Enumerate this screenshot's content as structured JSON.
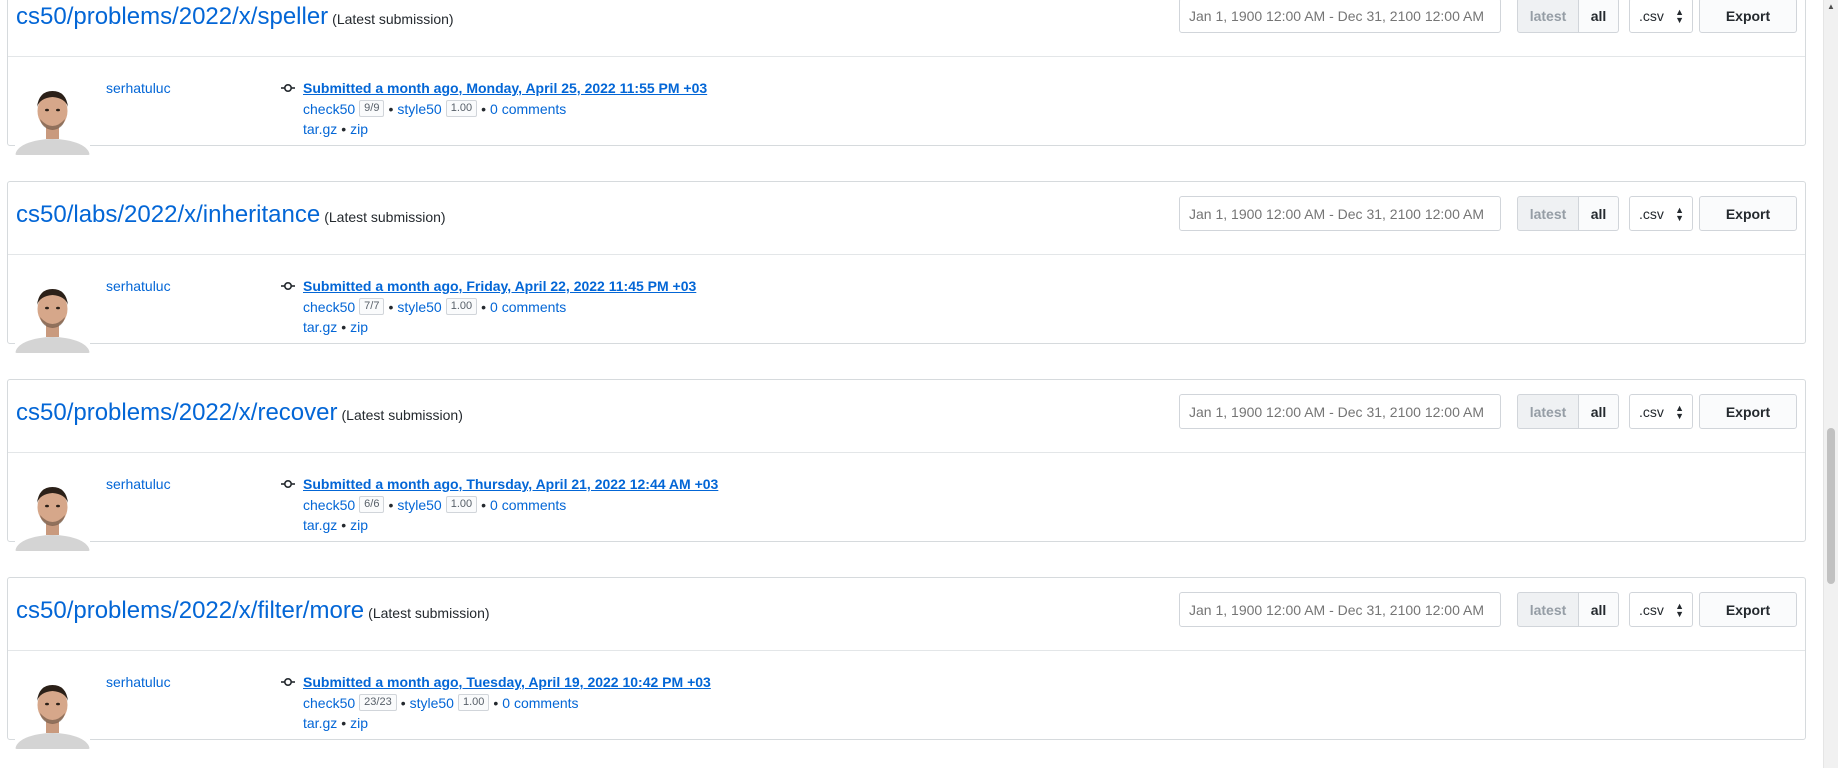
{
  "colors": {
    "link": "#0366d6",
    "border": "#d6dadd",
    "text": "#24292e"
  },
  "submissions": [
    {
      "slug": "cs50/problems/2022/x/speller",
      "note": "(Latest submission)",
      "date_range_placeholder": "Jan 1, 1900 12:00 AM - Dec 31, 2100 12:00 AM",
      "latest_label": "latest",
      "all_label": "all",
      "format": ".csv",
      "export_label": "Export",
      "user": "serhatuluc",
      "submitted": "Submitted a month ago, Monday, April 25, 2022 11:55 PM +03",
      "check_label": "check50",
      "check_score": "9/9",
      "style_label": "style50",
      "style_score": "1.00",
      "comments": "0 comments",
      "targz": "tar.gz",
      "zip": "zip"
    },
    {
      "slug": "cs50/labs/2022/x/inheritance",
      "note": "(Latest submission)",
      "date_range_placeholder": "Jan 1, 1900 12:00 AM - Dec 31, 2100 12:00 AM",
      "latest_label": "latest",
      "all_label": "all",
      "format": ".csv",
      "export_label": "Export",
      "user": "serhatuluc",
      "submitted": "Submitted a month ago, Friday, April 22, 2022 11:45 PM +03",
      "check_label": "check50",
      "check_score": "7/7",
      "style_label": "style50",
      "style_score": "1.00",
      "comments": "0 comments",
      "targz": "tar.gz",
      "zip": "zip"
    },
    {
      "slug": "cs50/problems/2022/x/recover",
      "note": "(Latest submission)",
      "date_range_placeholder": "Jan 1, 1900 12:00 AM - Dec 31, 2100 12:00 AM",
      "latest_label": "latest",
      "all_label": "all",
      "format": ".csv",
      "export_label": "Export",
      "user": "serhatuluc",
      "submitted": "Submitted a month ago, Thursday, April 21, 2022 12:44 AM +03",
      "check_label": "check50",
      "check_score": "6/6",
      "style_label": "style50",
      "style_score": "1.00",
      "comments": "0 comments",
      "targz": "tar.gz",
      "zip": "zip"
    },
    {
      "slug": "cs50/problems/2022/x/filter/more",
      "note": "(Latest submission)",
      "date_range_placeholder": "Jan 1, 1900 12:00 AM - Dec 31, 2100 12:00 AM",
      "latest_label": "latest",
      "all_label": "all",
      "format": ".csv",
      "export_label": "Export",
      "user": "serhatuluc",
      "submitted": "Submitted a month ago, Tuesday, April 19, 2022 10:42 PM +03",
      "check_label": "check50",
      "check_score": "23/23",
      "style_label": "style50",
      "style_score": "1.00",
      "comments": "0 comments",
      "targz": "tar.gz",
      "zip": "zip"
    }
  ]
}
